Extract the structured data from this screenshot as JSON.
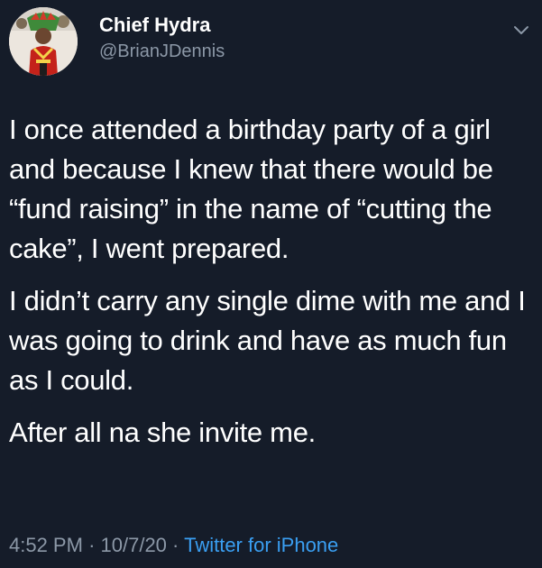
{
  "author": {
    "display_name": "Chief Hydra",
    "handle": "@BrianJDennis"
  },
  "tweet": {
    "paragraphs": [
      "I once attended a birthday party of a girl and because I knew that there would be “fund raising” in the name of “cutting the cake”, I went prepared.",
      "I didn’t carry any single dime with me and I was going to drink and have as much fun as I could.",
      "After all na she invite me."
    ],
    "time": "4:52 PM",
    "separator": "·",
    "date": "10/7/20",
    "source": "Twitter for iPhone"
  },
  "icons": {
    "avatar": "profile-photo",
    "caret": "chevron-down-icon"
  },
  "colors": {
    "background": "#151c29",
    "text": "#ffffff",
    "muted": "#8c98a7",
    "link": "#3a9ff2"
  }
}
